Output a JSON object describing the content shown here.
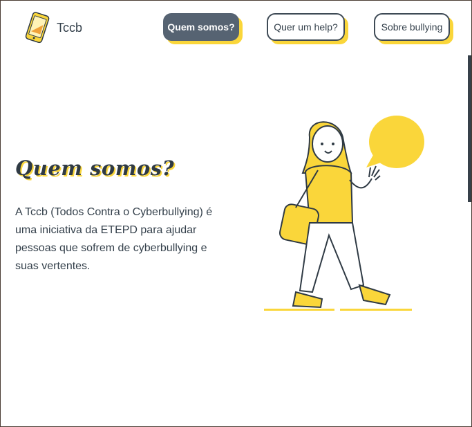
{
  "header": {
    "brand": "Tccb",
    "nav": [
      {
        "label": "Quem somos?",
        "active": true
      },
      {
        "label": "Quer um help?",
        "active": false
      },
      {
        "label": "Sobre bullying",
        "active": false
      }
    ]
  },
  "hero": {
    "title": "Quem somos?",
    "description": "A Tccb (Todos Contra o Cyberbullying) é uma iniciativa da ETEPD para ajudar pessoas que sofrem de cyberbullying e suas vertentes."
  },
  "colors": {
    "accent": "#fad63a",
    "dark": "#34404b",
    "active_button": "#566372"
  },
  "icons": [
    "phone-logo-icon",
    "girl-illustration",
    "speech-bubble-icon"
  ]
}
